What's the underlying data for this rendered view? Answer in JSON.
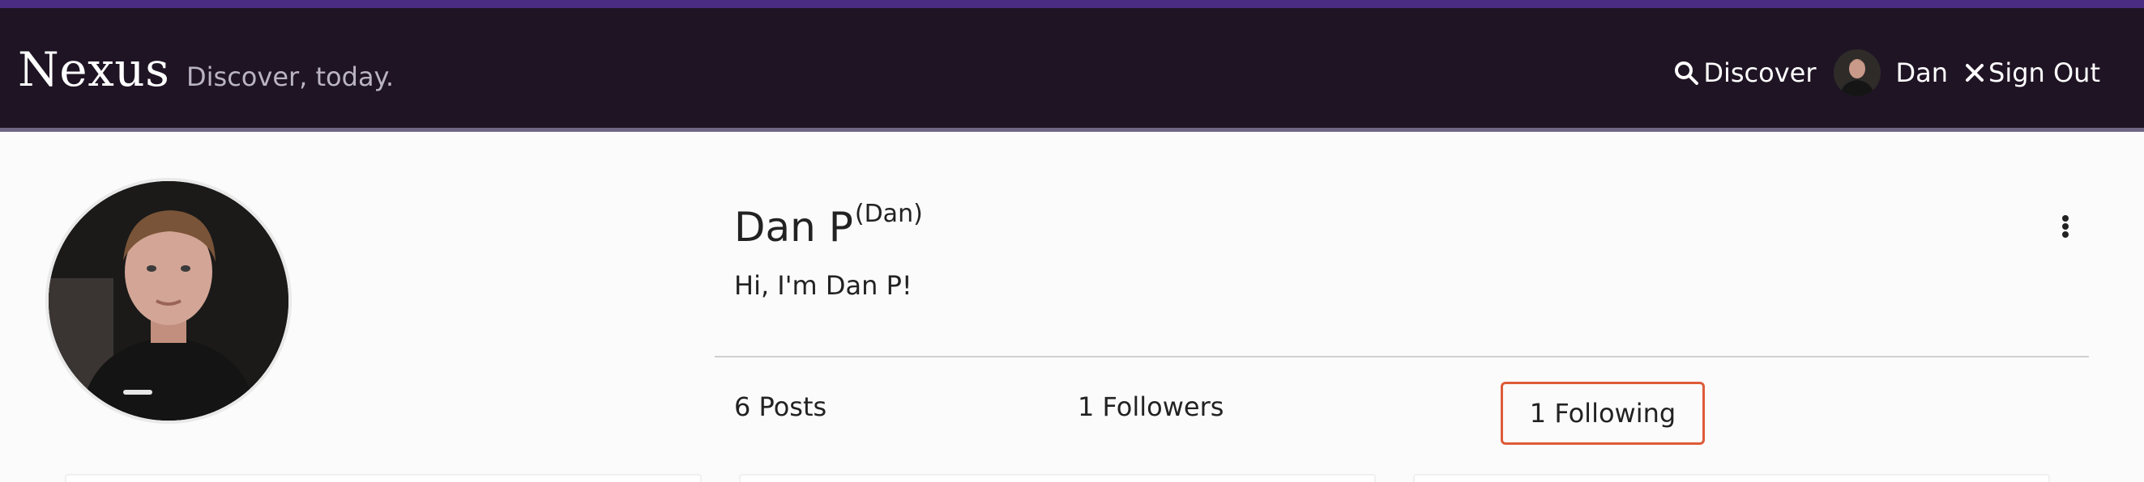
{
  "header": {
    "brand": "Nexus",
    "tagline": "Discover, today.",
    "discover_label": "Discover",
    "user_label": "Dan",
    "signout_label": "Sign Out"
  },
  "profile": {
    "display_name": "Dan P",
    "username": "(Dan)",
    "bio": "Hi, I'm Dan P!"
  },
  "stats": {
    "posts": "6 Posts",
    "followers": "1 Followers",
    "following": "1 Following"
  },
  "icons": {
    "discover": "search-icon",
    "signout": "close-icon",
    "menu": "more-vertical-icon"
  },
  "colors": {
    "nav_background": "#1f1424",
    "top_accent": "#4a2c82",
    "following_highlight": "#de5b3a"
  }
}
